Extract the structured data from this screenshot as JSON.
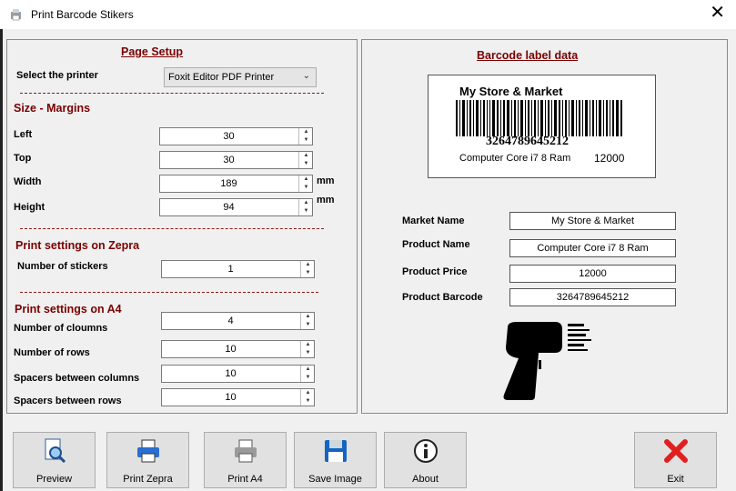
{
  "window": {
    "title": "Print Barcode Stikers",
    "close_glyph": "✕"
  },
  "page_setup": {
    "title": "Page Setup",
    "printer_label": "Select the printer",
    "printer_value": "Foxit Editor PDF Printer",
    "margins_title": "Size  - Margins",
    "left_label": "Left",
    "left_value": "30",
    "top_label": "Top",
    "top_value": "30",
    "width_label": "Width",
    "width_value": "189",
    "width_unit": "mm",
    "height_label": "Height",
    "height_value": "94",
    "height_unit": "mm",
    "zepra_title": "Print settings on Zepra",
    "stickers_label": "Number of  stickers",
    "stickers_value": "1",
    "a4_title": "Print settings on A4",
    "columns_label": "Number of cloumns",
    "columns_value": "4",
    "rows_label": "Number of rows",
    "rows_value": "10",
    "spacers_cols_label": "Spacers between columns",
    "spacers_cols_value": "10",
    "spacers_rows_label": "Spacers between rows",
    "spacers_rows_value": "10"
  },
  "barcode_panel": {
    "title": "Barcode label data",
    "card": {
      "store": "My Store & Market",
      "barcode_number": "3264789645212",
      "product": "Computer Core i7 8 Ram",
      "price": "12000"
    },
    "market_name_label": "Market Name",
    "market_name_value": "My Store & Market",
    "product_name_label": "Product Name",
    "product_name_value": "Computer Core i7 8 Ram",
    "product_price_label": "Product Price",
    "product_price_value": "12000",
    "product_barcode_label": "Product Barcode",
    "product_barcode_value": "3264789645212"
  },
  "buttons": {
    "preview": "Preview",
    "print_zepra": "Print Zepra",
    "print_a4": "Print A4",
    "save_image": "Save Image",
    "about": "About",
    "exit": "Exit"
  },
  "colors": {
    "section_title": "#7a0000",
    "exit_red": "#e02020",
    "save_blue": "#1565c0"
  }
}
